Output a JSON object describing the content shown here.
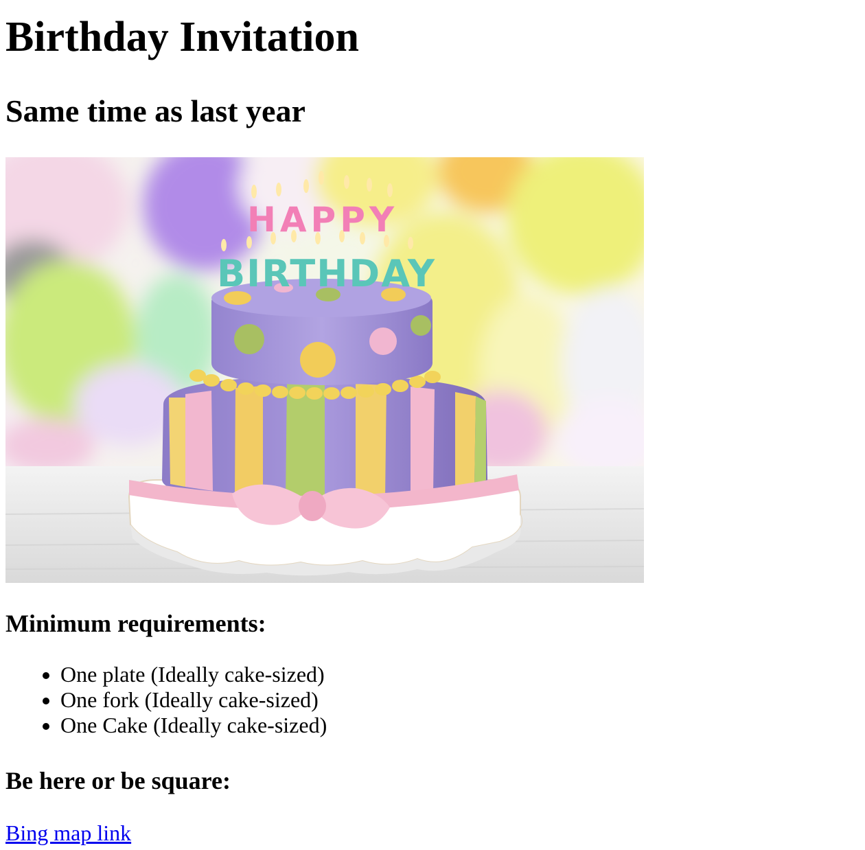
{
  "title": "Birthday Invitation",
  "subtitle": "Same time as last year",
  "image": {
    "cake_letters_top": "HAPPY",
    "cake_letters_bottom": "BIRTHDAY",
    "colors": {
      "purple": "#9b86d2",
      "pink": "#f2b7cf",
      "yellow": "#f2d06b",
      "green": "#b6cf6e",
      "balloon_yellow": "#eef07a",
      "balloon_purple": "#b18be8",
      "balloon_green": "#cbea7c"
    }
  },
  "requirements": {
    "heading": "Minimum requirements:",
    "items": [
      "One plate (Ideally cake-sized)",
      "One fork (Ideally cake-sized)",
      "One Cake (Ideally cake-sized)"
    ]
  },
  "location": {
    "heading": "Be here or be square:",
    "link_text": "Bing map link"
  },
  "colors": {
    "link": "#0000ee",
    "text": "#000000",
    "background": "#ffffff"
  }
}
